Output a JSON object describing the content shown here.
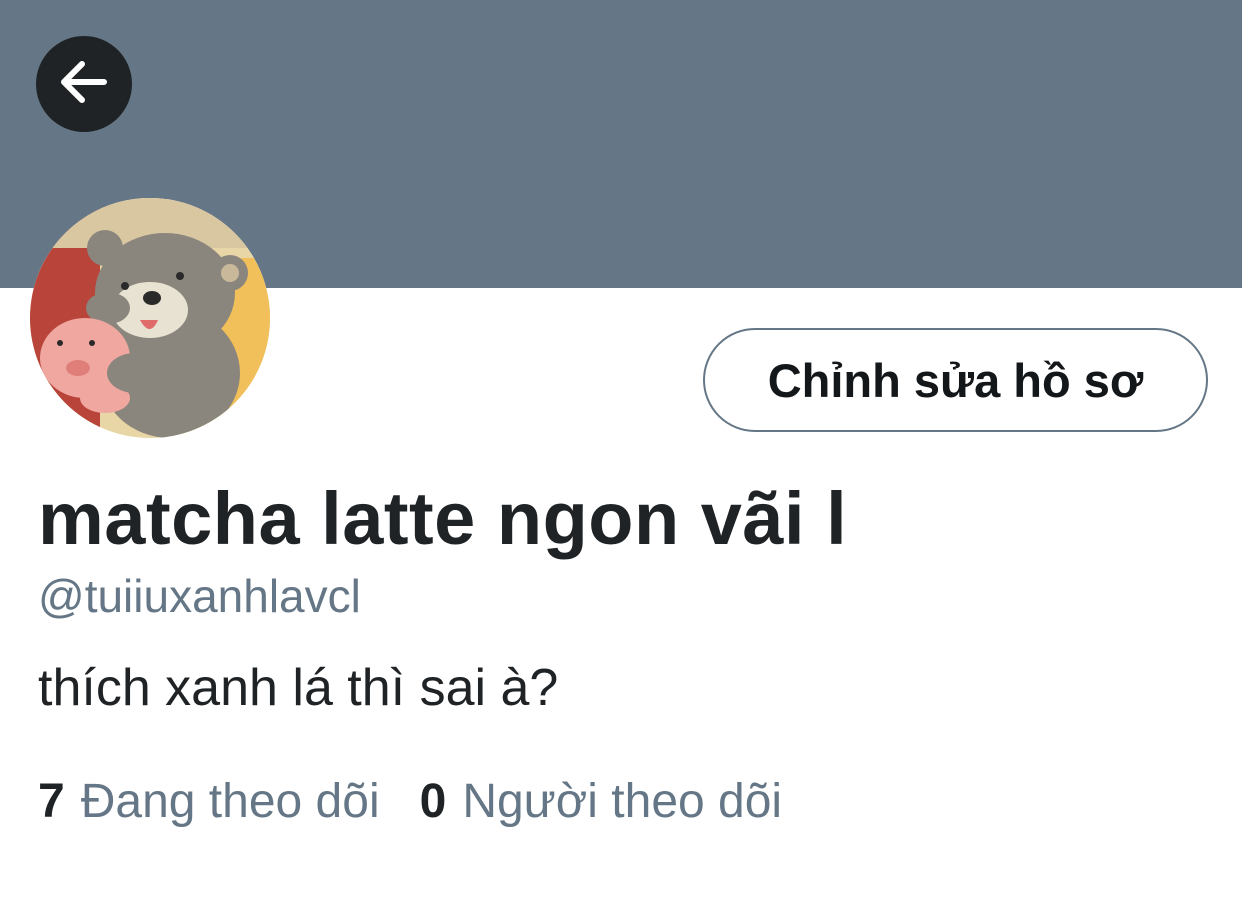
{
  "header": {
    "back_icon": "arrow-left-icon",
    "banner_color": "#657786"
  },
  "profile": {
    "avatar_alt": "avatar-illustration",
    "edit_button_label": "Chỉnh sửa hồ sơ",
    "display_name": "matcha latte ngon vãi l",
    "handle": "@tuiiuxanhlavcl",
    "bio": "thích xanh lá thì sai à?"
  },
  "stats": {
    "following_count": "7",
    "following_label": "Đang theo dõi",
    "followers_count": "0",
    "followers_label": "Người theo dõi"
  },
  "colors": {
    "text_primary": "#1f2326",
    "text_secondary": "#657786",
    "back_button_bg": "#1f2326"
  }
}
